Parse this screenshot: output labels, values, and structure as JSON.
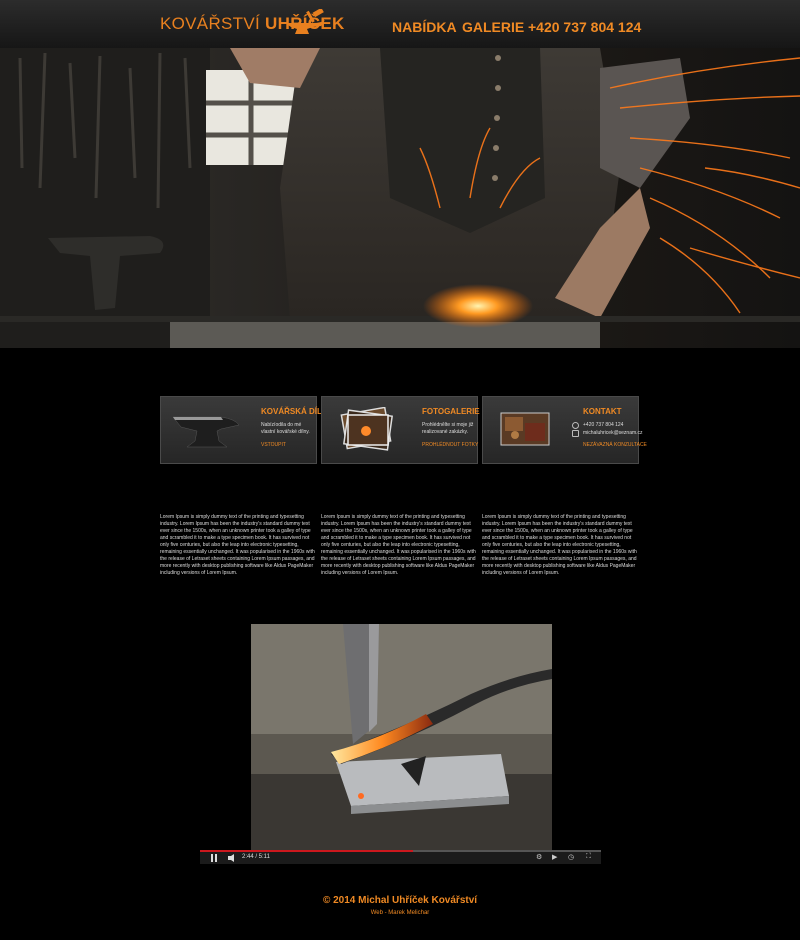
{
  "header": {
    "brand_light": "KOVÁŘSTVÍ",
    "brand_bold": "UHŘÍČEK",
    "nav": [
      {
        "label": "NABÍDKA"
      },
      {
        "label": "GALERIE"
      },
      {
        "label": "+420 737 804 124"
      }
    ]
  },
  "colors": {
    "accent": "#f08a24",
    "background": "#000000",
    "panel": "#2e2e2e"
  },
  "features": [
    {
      "title": "KOVÁŘSKÁ DÍLNA",
      "desc": "Nabízíodila do mé vlastní kovářské dílny.",
      "link": "VSTOUPIT",
      "icon": "anvil-image"
    },
    {
      "title": "FOTOGALERIE",
      "desc": "Prohlédnělte si moje již realizované zakázky.",
      "link": "PROHLÉDNOUT FOTKY",
      "icon": "photo-stack-image"
    },
    {
      "title": "KONTAKT",
      "phone": "+420 737 804 124",
      "email": "michaluhricek@seznam.cz",
      "link": "NEZÁVAZNÁ KONZULTACE",
      "icon": "workshop-image"
    }
  ],
  "columns": [
    "Lorem Ipsum is simply dummy text of the printing and typesetting industry. Lorem Ipsum has been the industry's standard dummy text ever since the 1500s, when an unknown printer took a galley of type and scrambled it to make a type specimen book. It has survived not only five centuries, but also the leap into electronic typesetting, remaining essentially unchanged. It was popularised in the 1960s with the release of Letraset sheets containing Lorem Ipsum passages, and more recently with desktop publishing software like Aldus PageMaker including versions of Lorem Ipsum.",
    "Lorem Ipsum is simply dummy text of the printing and typesetting industry. Lorem Ipsum has been the industry's standard dummy text ever since the 1500s, when an unknown printer took a galley of type and scrambled it to make a type specimen book. It has survived not only five centuries, but also the leap into electronic typesetting, remaining essentially unchanged. It was popularised in the 1960s with the release of Letraset sheets containing Lorem Ipsum passages, and more recently with desktop publishing software like Aldus PageMaker including versions of Lorem Ipsum.",
    "Lorem Ipsum is simply dummy text of the printing and typesetting industry. Lorem Ipsum has been the industry's standard dummy text ever since the 1500s, when an unknown printer took a galley of type and scrambled it to make a type specimen book. It has survived not only five centuries, but also the leap into electronic typesetting, remaining essentially unchanged. It was popularised in the 1960s with the release of Letraset sheets containing Lorem Ipsum passages, and more recently with desktop publishing software like Aldus PageMaker including versions of Lorem Ipsum."
  ],
  "video": {
    "time": "2:44 / 5:11",
    "progress": 0.53
  },
  "footer": {
    "copyright": "© 2014 Michal Uhříček Kovářství",
    "credit": "Web - Marek Melichar"
  }
}
